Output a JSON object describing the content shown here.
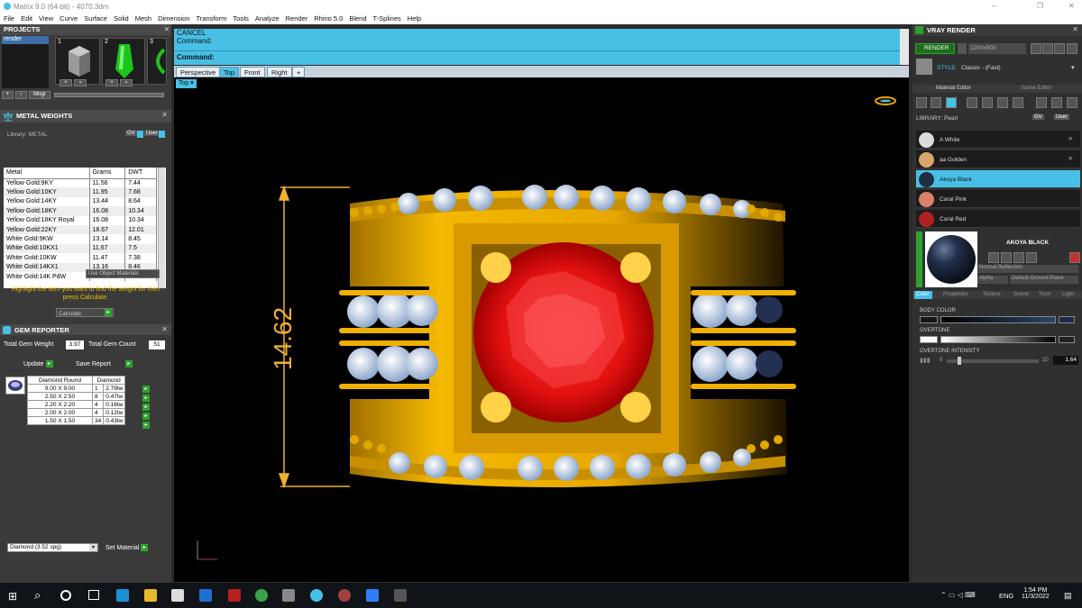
{
  "window": {
    "title": "Matrix 9.0 (64-bit) - 4070.3dm",
    "controls": [
      "–",
      "❐",
      "✕"
    ]
  },
  "menu": [
    "File",
    "Edit",
    "View",
    "Curve",
    "Surface",
    "Solid",
    "Mesh",
    "Dimension",
    "Transform",
    "Tools",
    "Analyze",
    "Render",
    "Rhino 5.0",
    "Blend",
    "T-Splines",
    "Help"
  ],
  "projects": {
    "title": "PROJECTS",
    "item": "render",
    "tiles": [
      "1",
      "2",
      "3"
    ],
    "buttons": [
      "+",
      "↑",
      "Mngr"
    ]
  },
  "metal_weights": {
    "title": "METAL WEIGHTS",
    "library_label": "Library: METAL",
    "gv": "GV",
    "user": "User",
    "columns": [
      "Metal",
      "Grams",
      "DWT"
    ],
    "rows": [
      [
        "Yellow Gold:9KY",
        "11.56",
        "7.44"
      ],
      [
        "Yellow Gold:10KY",
        "11.95",
        "7.68"
      ],
      [
        "Yellow Gold:14KY",
        "13.44",
        "8.64"
      ],
      [
        "Yellow Gold:18KY",
        "16.08",
        "10.34"
      ],
      [
        "Yellow Gold:18KY Royal",
        "16.08",
        "10.34"
      ],
      [
        "Yellow Gold:22KY",
        "18.67",
        "12.01"
      ],
      [
        "White Gold:9KW",
        "13.14",
        "8.45"
      ],
      [
        "White Gold:10KX1",
        "11.67",
        "7.5"
      ],
      [
        "White Gold:10KW",
        "11.47",
        "7.38"
      ],
      [
        "White Gold:14KX1",
        "13.16",
        "8.46"
      ],
      [
        "White Gold:14K PdW",
        "15.03",
        "9.66"
      ]
    ],
    "use_object": "Use Object Materials",
    "hint": "Highlight the item you want to find the weight for then press Calculate.",
    "calculate": "Calculate"
  },
  "gem_reporter": {
    "title": "GEM REPORTER",
    "total_weight_label": "Total Gem Weight",
    "total_weight": "3.97",
    "total_count_label": "Total Gem Count",
    "total_count": "51",
    "update": "Update",
    "save_report": "Save Report",
    "columns": [
      "Diamond Round",
      "Diamond"
    ],
    "rows": [
      [
        "9.00 X 9.00",
        "1",
        "2.79tw"
      ],
      [
        "2.50 X 2.50",
        "8",
        "0.47tw"
      ],
      [
        "2.20 X 2.20",
        "4",
        "0.16tw"
      ],
      [
        "2.00 X 2.00",
        "4",
        "0.12tw"
      ],
      [
        "1.50 X 1.50",
        "34",
        "0.43tw"
      ]
    ],
    "material_select": "Diamond   (3.52 spg)",
    "set_material": "Set Material"
  },
  "command": {
    "line1": "CANCEL",
    "line2": "Command:",
    "prompt": "Command:"
  },
  "viewport_tabs": [
    "Perspective",
    "Top",
    "Front",
    "Right",
    "+"
  ],
  "view_label": "Top",
  "dimension": "14.62",
  "vray": {
    "title": "VRAY RENDER",
    "render": "RENDER",
    "resolution": "1200x900",
    "style_label": "STYLE:",
    "style": "Classic - (Fast)",
    "tabs": [
      "Material Editor",
      "Scene Editor"
    ],
    "library": "LIBRARY: Pearl",
    "gv": "GV",
    "user": "User",
    "materials": [
      {
        "name": "A White",
        "color": "#dcdcdc"
      },
      {
        "name": "aa Golden",
        "color": "#d9a56a"
      },
      {
        "name": "Akoya Black",
        "color": "#1e2e44"
      },
      {
        "name": "Coral Pink",
        "color": "#d8826e"
      },
      {
        "name": "Coral Red",
        "color": "#b02020"
      }
    ],
    "preview_title": "AKOYA BLACK",
    "reflection": "Normal Reflection",
    "alpha": "Alpha",
    "ground": "Default Ground Plane",
    "sub_tabs": [
      "Color",
      "Properties",
      "Texture",
      "Scene",
      "Toon",
      "Light"
    ],
    "body_color": "BODY COLOR",
    "overtone": "OVERTONE",
    "overtone_intensity": "OVERTONE INTENSITY",
    "intensity_min": "0",
    "intensity_max": "10",
    "intensity_value": "1.64"
  },
  "taskbar": {
    "lang": "ENG",
    "time": "1:54 PM",
    "date": "11/3/2022"
  },
  "colors": {
    "accent": "#48c0e6",
    "gold": "#f0b400",
    "ruby": "#e01818"
  }
}
